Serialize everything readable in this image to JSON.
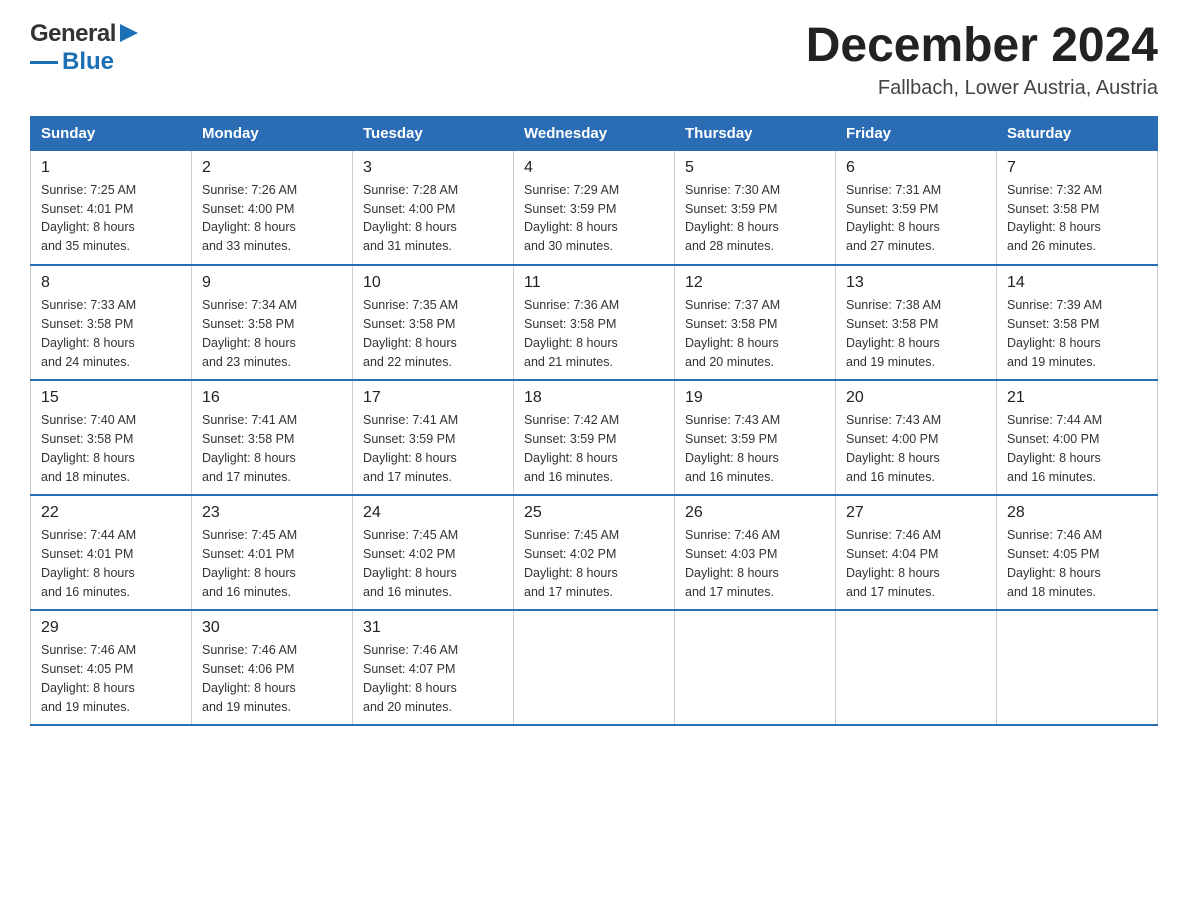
{
  "header": {
    "logo_general": "General",
    "logo_blue": "Blue",
    "month_year": "December 2024",
    "location": "Fallbach, Lower Austria, Austria"
  },
  "weekdays": [
    "Sunday",
    "Monday",
    "Tuesday",
    "Wednesday",
    "Thursday",
    "Friday",
    "Saturday"
  ],
  "weeks": [
    [
      {
        "day": "1",
        "sunrise": "7:25 AM",
        "sunset": "4:01 PM",
        "daylight": "8 hours and 35 minutes."
      },
      {
        "day": "2",
        "sunrise": "7:26 AM",
        "sunset": "4:00 PM",
        "daylight": "8 hours and 33 minutes."
      },
      {
        "day": "3",
        "sunrise": "7:28 AM",
        "sunset": "4:00 PM",
        "daylight": "8 hours and 31 minutes."
      },
      {
        "day": "4",
        "sunrise": "7:29 AM",
        "sunset": "3:59 PM",
        "daylight": "8 hours and 30 minutes."
      },
      {
        "day": "5",
        "sunrise": "7:30 AM",
        "sunset": "3:59 PM",
        "daylight": "8 hours and 28 minutes."
      },
      {
        "day": "6",
        "sunrise": "7:31 AM",
        "sunset": "3:59 PM",
        "daylight": "8 hours and 27 minutes."
      },
      {
        "day": "7",
        "sunrise": "7:32 AM",
        "sunset": "3:58 PM",
        "daylight": "8 hours and 26 minutes."
      }
    ],
    [
      {
        "day": "8",
        "sunrise": "7:33 AM",
        "sunset": "3:58 PM",
        "daylight": "8 hours and 24 minutes."
      },
      {
        "day": "9",
        "sunrise": "7:34 AM",
        "sunset": "3:58 PM",
        "daylight": "8 hours and 23 minutes."
      },
      {
        "day": "10",
        "sunrise": "7:35 AM",
        "sunset": "3:58 PM",
        "daylight": "8 hours and 22 minutes."
      },
      {
        "day": "11",
        "sunrise": "7:36 AM",
        "sunset": "3:58 PM",
        "daylight": "8 hours and 21 minutes."
      },
      {
        "day": "12",
        "sunrise": "7:37 AM",
        "sunset": "3:58 PM",
        "daylight": "8 hours and 20 minutes."
      },
      {
        "day": "13",
        "sunrise": "7:38 AM",
        "sunset": "3:58 PM",
        "daylight": "8 hours and 19 minutes."
      },
      {
        "day": "14",
        "sunrise": "7:39 AM",
        "sunset": "3:58 PM",
        "daylight": "8 hours and 19 minutes."
      }
    ],
    [
      {
        "day": "15",
        "sunrise": "7:40 AM",
        "sunset": "3:58 PM",
        "daylight": "8 hours and 18 minutes."
      },
      {
        "day": "16",
        "sunrise": "7:41 AM",
        "sunset": "3:58 PM",
        "daylight": "8 hours and 17 minutes."
      },
      {
        "day": "17",
        "sunrise": "7:41 AM",
        "sunset": "3:59 PM",
        "daylight": "8 hours and 17 minutes."
      },
      {
        "day": "18",
        "sunrise": "7:42 AM",
        "sunset": "3:59 PM",
        "daylight": "8 hours and 16 minutes."
      },
      {
        "day": "19",
        "sunrise": "7:43 AM",
        "sunset": "3:59 PM",
        "daylight": "8 hours and 16 minutes."
      },
      {
        "day": "20",
        "sunrise": "7:43 AM",
        "sunset": "4:00 PM",
        "daylight": "8 hours and 16 minutes."
      },
      {
        "day": "21",
        "sunrise": "7:44 AM",
        "sunset": "4:00 PM",
        "daylight": "8 hours and 16 minutes."
      }
    ],
    [
      {
        "day": "22",
        "sunrise": "7:44 AM",
        "sunset": "4:01 PM",
        "daylight": "8 hours and 16 minutes."
      },
      {
        "day": "23",
        "sunrise": "7:45 AM",
        "sunset": "4:01 PM",
        "daylight": "8 hours and 16 minutes."
      },
      {
        "day": "24",
        "sunrise": "7:45 AM",
        "sunset": "4:02 PM",
        "daylight": "8 hours and 16 minutes."
      },
      {
        "day": "25",
        "sunrise": "7:45 AM",
        "sunset": "4:02 PM",
        "daylight": "8 hours and 17 minutes."
      },
      {
        "day": "26",
        "sunrise": "7:46 AM",
        "sunset": "4:03 PM",
        "daylight": "8 hours and 17 minutes."
      },
      {
        "day": "27",
        "sunrise": "7:46 AM",
        "sunset": "4:04 PM",
        "daylight": "8 hours and 17 minutes."
      },
      {
        "day": "28",
        "sunrise": "7:46 AM",
        "sunset": "4:05 PM",
        "daylight": "8 hours and 18 minutes."
      }
    ],
    [
      {
        "day": "29",
        "sunrise": "7:46 AM",
        "sunset": "4:05 PM",
        "daylight": "8 hours and 19 minutes."
      },
      {
        "day": "30",
        "sunrise": "7:46 AM",
        "sunset": "4:06 PM",
        "daylight": "8 hours and 19 minutes."
      },
      {
        "day": "31",
        "sunrise": "7:46 AM",
        "sunset": "4:07 PM",
        "daylight": "8 hours and 20 minutes."
      },
      null,
      null,
      null,
      null
    ]
  ]
}
